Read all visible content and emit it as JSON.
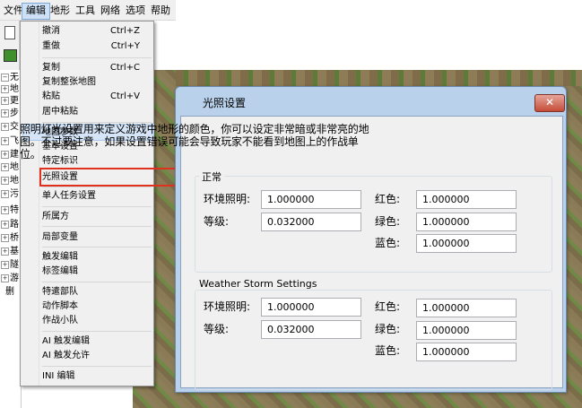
{
  "menubar": {
    "items": [
      "文件",
      "编辑",
      "地形",
      "工具",
      "网络",
      "选项",
      "帮助"
    ]
  },
  "tree": {
    "rows": [
      "无",
      "地",
      "更",
      "步",
      "交",
      "飞",
      "建",
      "地",
      "地",
      "污",
      "特",
      "路",
      "桥",
      "基",
      "隧",
      "游",
      "删"
    ]
  },
  "edit_menu": {
    "items": [
      {
        "label": "撤消",
        "shortcut": "Ctrl+Z"
      },
      {
        "label": "重做",
        "shortcut": "Ctrl+Y"
      },
      {
        "label": "复制",
        "shortcut": "Ctrl+C"
      },
      {
        "label": "复制整张地图",
        "shortcut": ""
      },
      {
        "label": "粘贴",
        "shortcut": "Ctrl+V"
      },
      {
        "label": "居中粘贴",
        "shortcut": ""
      },
      {
        "label": "地图参数",
        "shortcut": ""
      },
      {
        "label": "基本设置",
        "shortcut": ""
      },
      {
        "label": "特定标识",
        "shortcut": ""
      },
      {
        "label": "光照设置",
        "shortcut": ""
      },
      {
        "label": "单人任务设置",
        "shortcut": ""
      },
      {
        "label": "所属方",
        "shortcut": ""
      },
      {
        "label": "局部变量",
        "shortcut": ""
      },
      {
        "label": "触发编辑",
        "shortcut": ""
      },
      {
        "label": "标签编辑",
        "shortcut": ""
      },
      {
        "label": "特遣部队",
        "shortcut": ""
      },
      {
        "label": "动作脚本",
        "shortcut": ""
      },
      {
        "label": "作战小队",
        "shortcut": ""
      },
      {
        "label": "AI 触发编辑",
        "shortcut": ""
      },
      {
        "label": "AI 触发允许",
        "shortcut": ""
      },
      {
        "label": "INI 编辑",
        "shortcut": ""
      }
    ]
  },
  "dialog": {
    "title": "光照设置",
    "close": "✕",
    "description": "照明灯光设置用来定义游戏中地形的颜色，你可以设定非常暗或非常亮的地图。不过要注意，如果设置错误可能会导致玩家不能看到地图上的作战单位。",
    "normal": {
      "title": "正常",
      "ambient_label": "环境照明:",
      "ambient_value": "1.000000",
      "level_label": "等级:",
      "level_value": "0.032000",
      "red_label": "红色:",
      "red_value": "1.000000",
      "green_label": "绿色:",
      "green_value": "1.000000",
      "blue_label": "蓝色:",
      "blue_value": "1.000000"
    },
    "storm": {
      "title": "Weather Storm Settings",
      "ambient_label": "环境照明:",
      "ambient_value": "1.000000",
      "level_label": "等级:",
      "level_value": "0.032000",
      "red_label": "红色:",
      "red_value": "1.000000",
      "green_label": "绿色:",
      "green_value": "1.000000",
      "blue_label": "蓝色:",
      "blue_value": "1.000000"
    }
  }
}
